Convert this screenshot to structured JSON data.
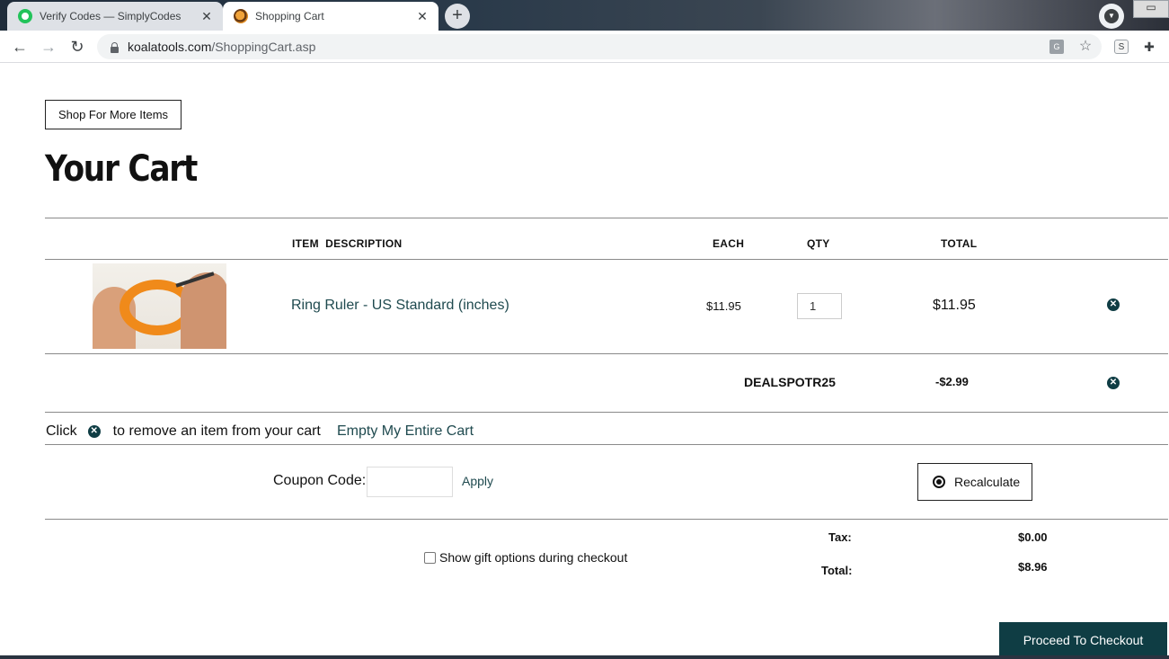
{
  "browser": {
    "tabs": [
      {
        "title": "Verify Codes — SimplyCodes",
        "active": false,
        "favicon": "simplycodes-icon"
      },
      {
        "title": "Shopping Cart",
        "active": true,
        "favicon": "koala-icon"
      }
    ],
    "url_host": "koalatools.com",
    "url_path": "/ShoppingCart.asp",
    "new_tab_symbol": "+",
    "close_symbol": "✕"
  },
  "page": {
    "shop_more_label": "Shop For More Items",
    "title": "Your Cart",
    "columns": {
      "description": "ITEM  DESCRIPTION",
      "each": "EACH",
      "qty": "QTY",
      "total": "TOTAL"
    },
    "items": [
      {
        "name": "Ring Ruler - US Standard (inches)",
        "each": "$11.95",
        "qty": "1",
        "total": "$11.95"
      }
    ],
    "coupon_applied": {
      "code": "DEALSPOTR25",
      "amount": "-$2.99"
    },
    "hint_prefix": "Click",
    "hint_suffix": "to remove an item from your cart",
    "empty_cart_label": "Empty My Entire Cart",
    "coupon_label": "Coupon Code:",
    "coupon_value": "",
    "apply_label": "Apply",
    "recalculate_label": "Recalculate",
    "gift_options_label": "Show gift options during checkout",
    "tax_label": "Tax:",
    "tax_value": "$0.00",
    "total_label": "Total:",
    "total_value": "$8.96",
    "checkout_label": "Proceed To Checkout"
  },
  "colors": {
    "accent": "#0f3d44",
    "link": "#1f4a4f"
  }
}
